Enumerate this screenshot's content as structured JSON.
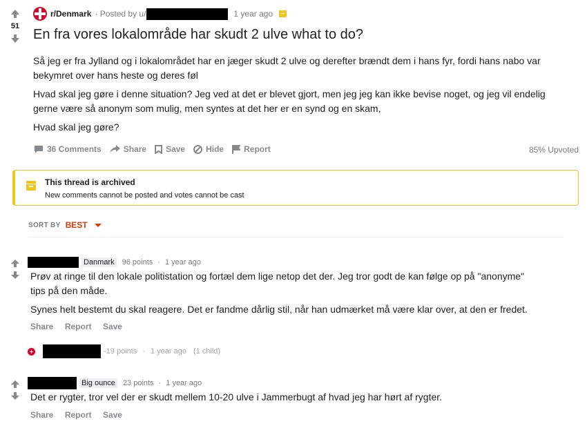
{
  "post": {
    "score": "51",
    "subreddit": "r/Denmark",
    "posted_by": "· Posted by u/",
    "age": "1 year ago",
    "title": "En fra vores lokalområde har skudt 2 ulve what to do?",
    "paragraphs": [
      "Så jeg er fra Jylland og i lokalområdet har en jæger skudt 2 ulve og derefter brændt dem i hans fyr, fordi hans nabo var bekymret over hans heste og deres føl",
      "Hvad skal jeg gøre i denne situation? Jeg ved at det er blevet gjort, men jeg jeg kan ikke bevise noget, og jeg vil endelig gerne være så anonym som mulig, men syntes at det her er en synd og en skam,",
      "Hvad skal jeg gøre?"
    ],
    "actions": {
      "comments": "36 Comments",
      "share": "Share",
      "save": "Save",
      "hide": "Hide",
      "report": "Report"
    },
    "upvoted": "85% Upvoted"
  },
  "archive": {
    "title": "This thread is archived",
    "text": "New comments cannot be posted and votes cannot be cast"
  },
  "sort": {
    "label": "SORT BY",
    "value": "BEST"
  },
  "comments": [
    {
      "flair": "Danmark",
      "points": "96 points",
      "age": "1 year ago",
      "paragraphs": [
        "Prøv at ringe til den lokale politistation og fortæl dem lige netop det der. Jeg tror godt de kan følge op på \"anonyme\" tips på den måde.",
        "Synes helt bestemt du skal reagere. Det er fandme dårlig stil, når han udmærket må være klar over, at den er fredet."
      ],
      "actions": [
        "Share",
        "Report",
        "Save"
      ]
    },
    {
      "collapsed": true,
      "points": "-19 points",
      "age": "1 year ago",
      "children": "(1 child)"
    },
    {
      "flair": "Big ounce",
      "points": "23 points",
      "age": "1 year ago",
      "paragraphs": [
        "Det er rygter, tror vel der er skudt mellem 10-20 ulve i Jammerbugt af hvad jeg har hørt af rygter."
      ],
      "actions": [
        "Share",
        "Report",
        "Save"
      ]
    }
  ],
  "colors": {
    "accent": "#d93a00",
    "archive_border": "#f0c419",
    "meta": "#787c7e"
  }
}
